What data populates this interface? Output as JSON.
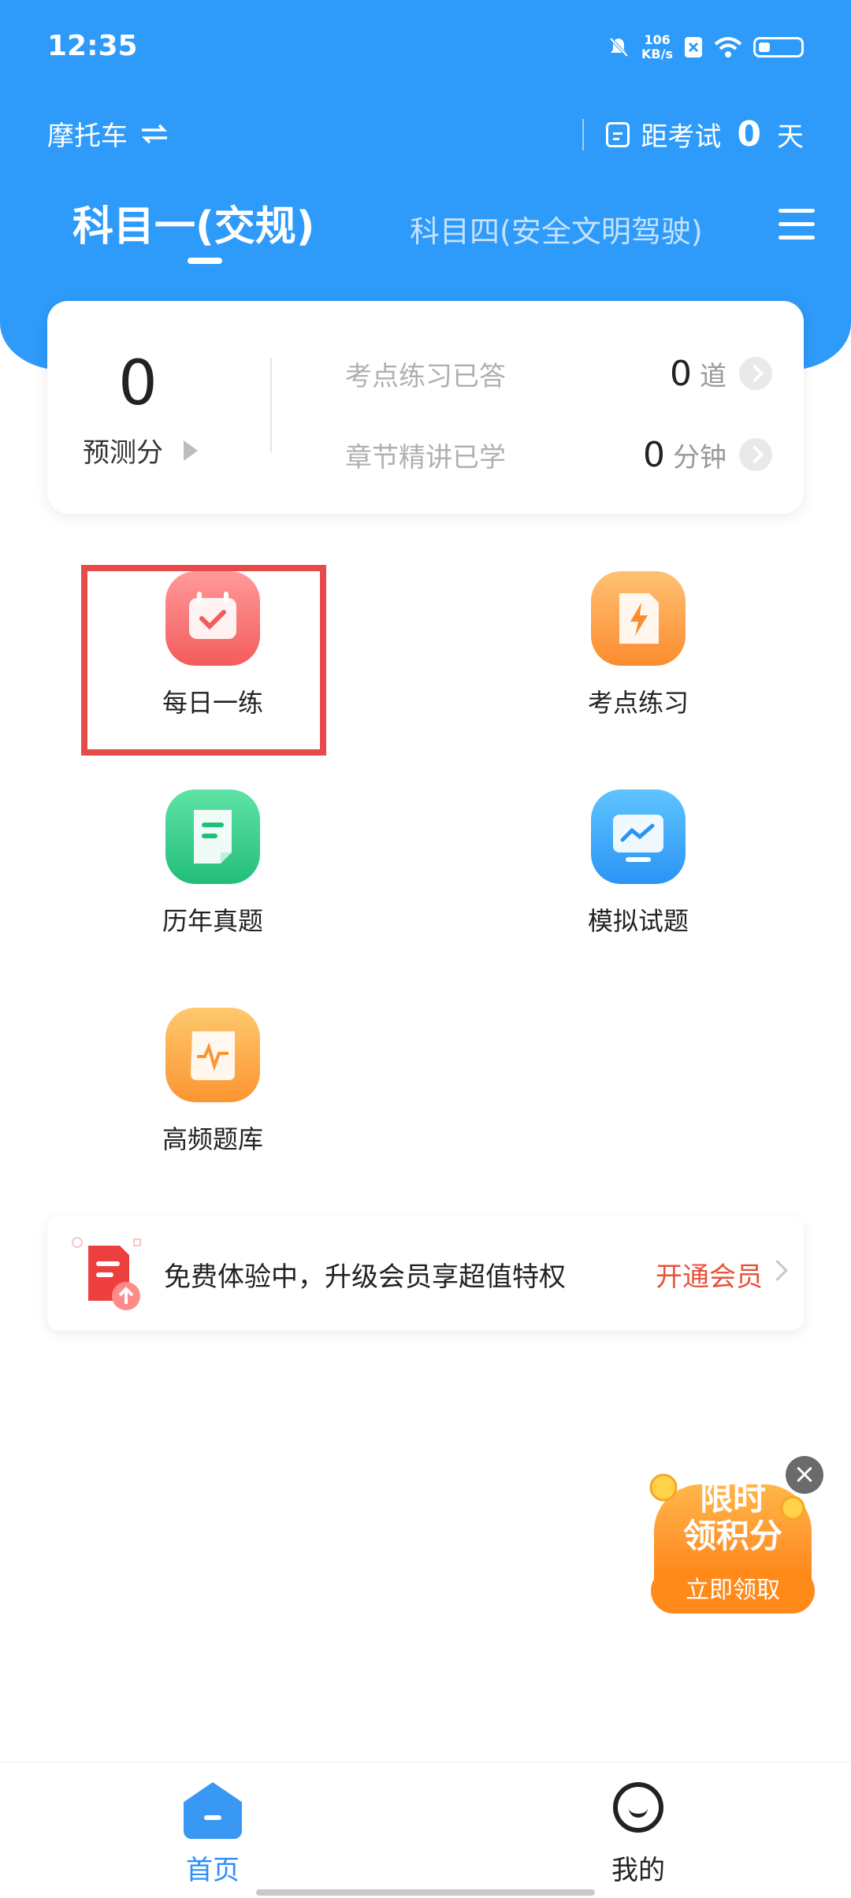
{
  "status": {
    "time": "12:35",
    "net_speed": "106",
    "net_unit": "KB/s"
  },
  "topbar": {
    "vehicle": "摩托车",
    "countdown_prefix": "距考试",
    "countdown_days": "0",
    "countdown_unit": "天"
  },
  "tabs": [
    {
      "label": "科目一(交规)",
      "active": true
    },
    {
      "label": "科目四(安全文明驾驶)",
      "active": false
    }
  ],
  "stats": {
    "score": "0",
    "score_label": "预测分",
    "rows": [
      {
        "label": "考点练习已答",
        "value": "0",
        "unit": "道"
      },
      {
        "label": "章节精讲已学",
        "value": "0",
        "unit": "分钟"
      }
    ]
  },
  "grid": [
    {
      "label": "每日一练",
      "icon": "calendar-check-icon",
      "color": "#f35c5c",
      "highlighted": true
    },
    {
      "label": "考点练习",
      "icon": "lightning-doc-icon",
      "color": "#fb8c2f"
    },
    {
      "label": "历年真题",
      "icon": "document-icon",
      "color": "#22bd7a"
    },
    {
      "label": "模拟试题",
      "icon": "monitor-chart-icon",
      "color": "#2a94f5"
    },
    {
      "label": "高频题库",
      "icon": "scroll-pulse-icon",
      "color": "#fb9531"
    }
  ],
  "promo": {
    "text": "免费体验中，升级会员享超值特权",
    "cta": "开通会员"
  },
  "floating": {
    "title_line1": "限时",
    "title_line2": "领积分",
    "button": "立即领取"
  },
  "bottom_nav": [
    {
      "label": "首页",
      "active": true
    },
    {
      "label": "我的",
      "active": false
    }
  ],
  "colors": {
    "primary": "#2e9af9",
    "accent": "#e8523a",
    "highlight_box": "#e84a4a"
  }
}
